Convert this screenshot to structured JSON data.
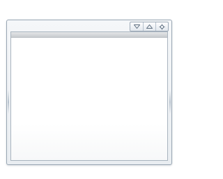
{
  "window": {
    "title": "",
    "controls": [
      {
        "name": "minimize",
        "icon": "triangle-down-icon"
      },
      {
        "name": "maximize",
        "icon": "triangle-up-icon"
      },
      {
        "name": "close",
        "icon": "gear-icon"
      }
    ]
  },
  "colors": {
    "frame_border": "#9aa7b4",
    "frame_bg": "#eef1f4",
    "client_bg": "#ffffff",
    "toolbar_strip": "#c9cccf"
  }
}
